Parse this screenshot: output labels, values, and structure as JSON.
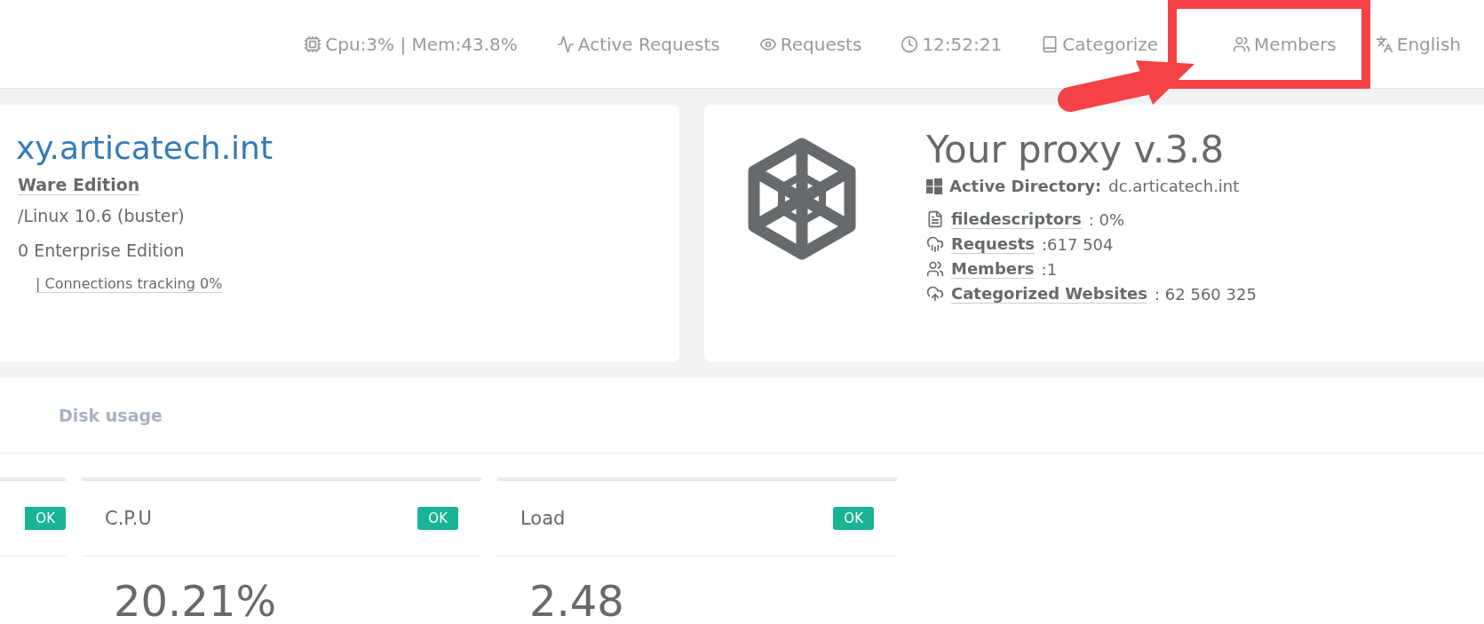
{
  "top_bar": {
    "items": [
      {
        "label": "Cpu:3% | Mem:43.8%"
      },
      {
        "label": "Active Requests"
      },
      {
        "label": "Requests"
      },
      {
        "label": "12:52:21"
      },
      {
        "label": "Categorize"
      },
      {
        "label": "Members"
      },
      {
        "label": "English"
      }
    ]
  },
  "server_card": {
    "hostname": "xy.articatech.int",
    "edition": "Ware Edition",
    "lines": [
      "/Linux 10.6 (buster)",
      "0 Enterprise Edition"
    ],
    "tracking": "| Connections tracking 0%"
  },
  "proxy_card": {
    "title": "Your proxy v.3.8",
    "directory_label": "Active Directory:",
    "directory_value": "dc.articatech.int",
    "stats": [
      {
        "label": "filedescriptors",
        "value": ": 0%"
      },
      {
        "label": "Requests",
        "value": ":617 504"
      },
      {
        "label": "Members",
        "value": ":1"
      },
      {
        "label": "Categorized Websites",
        "value": ": 62 560 325"
      }
    ]
  },
  "tabs": [
    {
      "label": "Disk usage",
      "selected": false
    }
  ],
  "widgets": [
    {
      "status": "OK"
    },
    {
      "title": "C.P.U",
      "status": "OK",
      "value": "20.21%"
    },
    {
      "title": "Load",
      "status": "OK",
      "value": "2.48"
    }
  ]
}
